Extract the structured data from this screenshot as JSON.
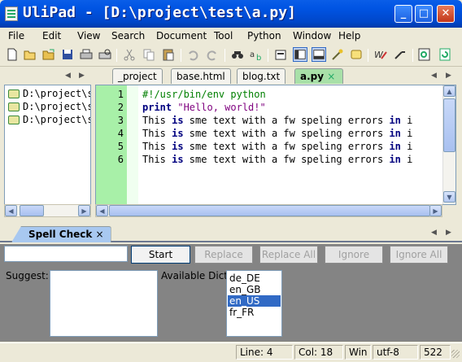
{
  "window": {
    "title": "UliPad - [D:\\project\\test\\a.py]",
    "min_icon": "minimize-icon",
    "max_icon": "maximize-icon",
    "close_icon": "close-icon"
  },
  "menu": [
    "File",
    "Edit",
    "View",
    "Search",
    "Document",
    "Tool",
    "Python",
    "Window",
    "Help"
  ],
  "toolbar_icons": [
    "new-file-icon",
    "open-file-icon",
    "open-folder-icon",
    "save-icon",
    "print-icon",
    "print-preview-icon",
    "cut-icon",
    "copy-icon",
    "paste-icon",
    "undo-icon",
    "redo-icon",
    "find-icon",
    "replace-icon",
    "preferences-icon",
    "layout-left-icon",
    "layout-bottom-icon",
    "wizard-icon",
    "script-icon",
    "spell-check-icon",
    "run-icon",
    "search-files-icon",
    "refresh-icon"
  ],
  "tabs": [
    {
      "label": "_project"
    },
    {
      "label": "base.html"
    },
    {
      "label": "blog.txt"
    },
    {
      "label": "a.py",
      "active": true,
      "close": "×"
    }
  ],
  "tree": [
    "D:\\project\\s",
    "D:\\project\\s",
    "D:\\project\\s"
  ],
  "editor": {
    "lines": [
      "1",
      "2",
      "3",
      "4",
      "5",
      "6"
    ],
    "code": [
      [
        {
          "t": "#!/usr/bin/env python",
          "c": "cm"
        }
      ],
      [
        {
          "t": "print",
          "c": "kw"
        },
        {
          "t": " ",
          "c": ""
        },
        {
          "t": "\"Hello, world!\"",
          "c": "st"
        }
      ],
      [
        {
          "t": "This ",
          "c": ""
        },
        {
          "t": "is",
          "c": "kw"
        },
        {
          "t": " sme text with a fw speling errors ",
          "c": ""
        },
        {
          "t": "in",
          "c": "kw"
        },
        {
          "t": " i",
          "c": ""
        }
      ],
      [
        {
          "t": "This ",
          "c": ""
        },
        {
          "t": "is",
          "c": "kw"
        },
        {
          "t": " sme text with a fw speling errors ",
          "c": ""
        },
        {
          "t": "in",
          "c": "kw"
        },
        {
          "t": " i",
          "c": ""
        }
      ],
      [
        {
          "t": "This ",
          "c": ""
        },
        {
          "t": "is",
          "c": "kw"
        },
        {
          "t": " sme text with a fw speling errors ",
          "c": ""
        },
        {
          "t": "in",
          "c": "kw"
        },
        {
          "t": " i",
          "c": ""
        }
      ],
      [
        {
          "t": "This ",
          "c": ""
        },
        {
          "t": "is",
          "c": "kw"
        },
        {
          "t": " sme text with a fw speling errors ",
          "c": ""
        },
        {
          "t": "in",
          "c": "kw"
        },
        {
          "t": " i",
          "c": ""
        }
      ]
    ]
  },
  "spell": {
    "tab_label": "Spell Check",
    "tab_close": "×",
    "input_value": "",
    "start": "Start",
    "replace": "Replace",
    "replace_all": "Replace All",
    "ignore": "Ignore",
    "ignore_all": "Ignore All",
    "suggest_label": "Suggest:",
    "dict_label": "Available Dict:",
    "dicts": [
      "de_DE",
      "en_GB",
      "en_US",
      "fr_FR"
    ],
    "selected_dict": "en_US"
  },
  "status": {
    "line": "Line: 4",
    "col": "Col: 18",
    "eol": "Win",
    "enc": "utf-8",
    "size": "522"
  }
}
